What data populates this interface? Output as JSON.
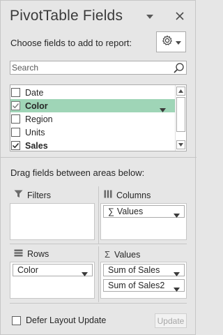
{
  "pane": {
    "title": "PivotTable Fields",
    "choose_label": "Choose fields to add to report:"
  },
  "search": {
    "placeholder": "Search"
  },
  "fields": [
    {
      "label": "Date",
      "checked": false,
      "bold": false,
      "selected": false
    },
    {
      "label": "Color",
      "checked": true,
      "bold": true,
      "selected": true
    },
    {
      "label": "Region",
      "checked": false,
      "bold": false,
      "selected": false
    },
    {
      "label": "Units",
      "checked": false,
      "bold": false,
      "selected": false
    },
    {
      "label": "Sales",
      "checked": true,
      "bold": true,
      "selected": false
    }
  ],
  "drag_label": "Drag fields between areas below:",
  "areas": {
    "filters": {
      "label": "Filters",
      "items": []
    },
    "columns": {
      "label": "Columns",
      "items": [
        {
          "label": "Values",
          "sigma": "∑"
        }
      ]
    },
    "rows": {
      "label": "Rows",
      "items": [
        {
          "label": "Color"
        }
      ]
    },
    "values": {
      "label": "Values",
      "items": [
        {
          "label": "Sum of Sales"
        },
        {
          "label": "Sum of Sales2"
        }
      ]
    }
  },
  "defer": {
    "label": "Defer Layout Update",
    "checked": false
  },
  "update_button": "Update",
  "colors": {
    "selected_row": "#9fd5b7",
    "pane_bg": "#e6e6e6"
  },
  "icons": {
    "title_dropdown": "triangle-down-icon",
    "close": "close-icon",
    "tools": "gear-icon",
    "search": "search-icon",
    "filters": "filter-icon",
    "columns": "columns-icon",
    "rows": "rows-icon",
    "values": "sigma-icon"
  }
}
